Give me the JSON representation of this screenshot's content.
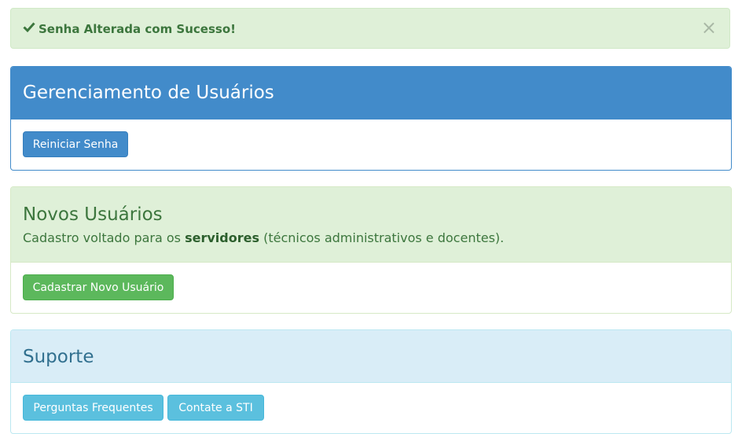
{
  "alert": {
    "icon": "check-icon",
    "message": "Senha Alterada com Sucesso!",
    "close_label": "×"
  },
  "panels": {
    "users": {
      "title": "Gerenciamento de Usuários",
      "button": "Reiniciar Senha"
    },
    "new_users": {
      "title": "Novos Usuários",
      "subtitle_pre": "Cadastro voltado para os ",
      "subtitle_bold": "servidores",
      "subtitle_post": " (técnicos administrativos e docentes).",
      "button": "Cadastrar Novo Usuário"
    },
    "support": {
      "title": "Suporte",
      "buttons": [
        "Perguntas Frequentes",
        "Contate a STI"
      ]
    }
  },
  "colors": {
    "primary": "#428bca",
    "success": "#5cb85c",
    "info": "#5bc0de",
    "success_bg": "#dff0d8",
    "info_bg": "#d9edf7"
  }
}
